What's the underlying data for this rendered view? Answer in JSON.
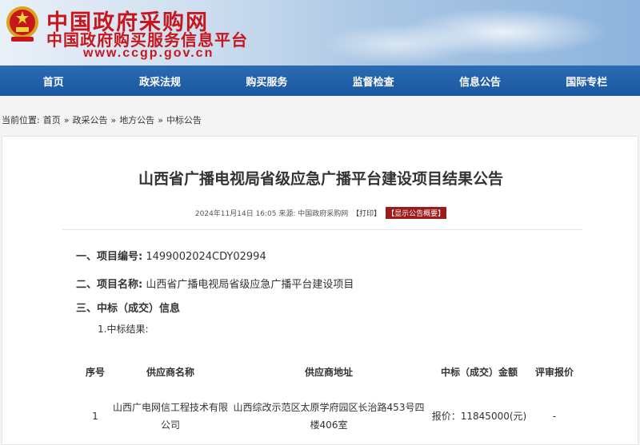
{
  "header": {
    "site_name": "中国政府采购网",
    "site_sub": "中国政府购买服务信息平台",
    "site_url": "www.ccgp.gov.cn"
  },
  "nav": {
    "items": [
      "首页",
      "政采法规",
      "购买服务",
      "监督检查",
      "信息公告",
      "国际专栏"
    ]
  },
  "breadcrumb": {
    "label": "当前位置:",
    "items": [
      "首页",
      "政采公告",
      "地方公告",
      "中标公告"
    ],
    "sep": "»"
  },
  "article": {
    "title": "山西省广播电视局省级应急广播平台建设项目结果公告",
    "meta_text": "2024年11月14日 16:05 来源:",
    "meta_source": "中国政府采购网",
    "print_label": "【打印】",
    "overview_label": "【显示公告概要】"
  },
  "sections": {
    "s1_label": "一、项目编号:",
    "s1_value": "1499002024CDY02994",
    "s2_label": "二、项目名称:",
    "s2_value": "山西省广播电视局省级应急广播平台建设项目",
    "s3_label": "三、中标（成交）信息",
    "s3_sub": "1.中标结果:"
  },
  "table": {
    "headers": [
      "序号",
      "供应商名称",
      "供应商地址",
      "中标（成交）金额",
      "评审报价"
    ],
    "rows": [
      [
        "1",
        "山西广电网信工程技术有限公司",
        "山西综改示范区太原学府园区长治路453号四楼406室",
        "报价：11845000(元)",
        "-"
      ]
    ]
  },
  "colors": {
    "brand_red": "#c8161d",
    "nav_blue": "#1a57a0",
    "overview_bg": "#9b1c1c"
  }
}
